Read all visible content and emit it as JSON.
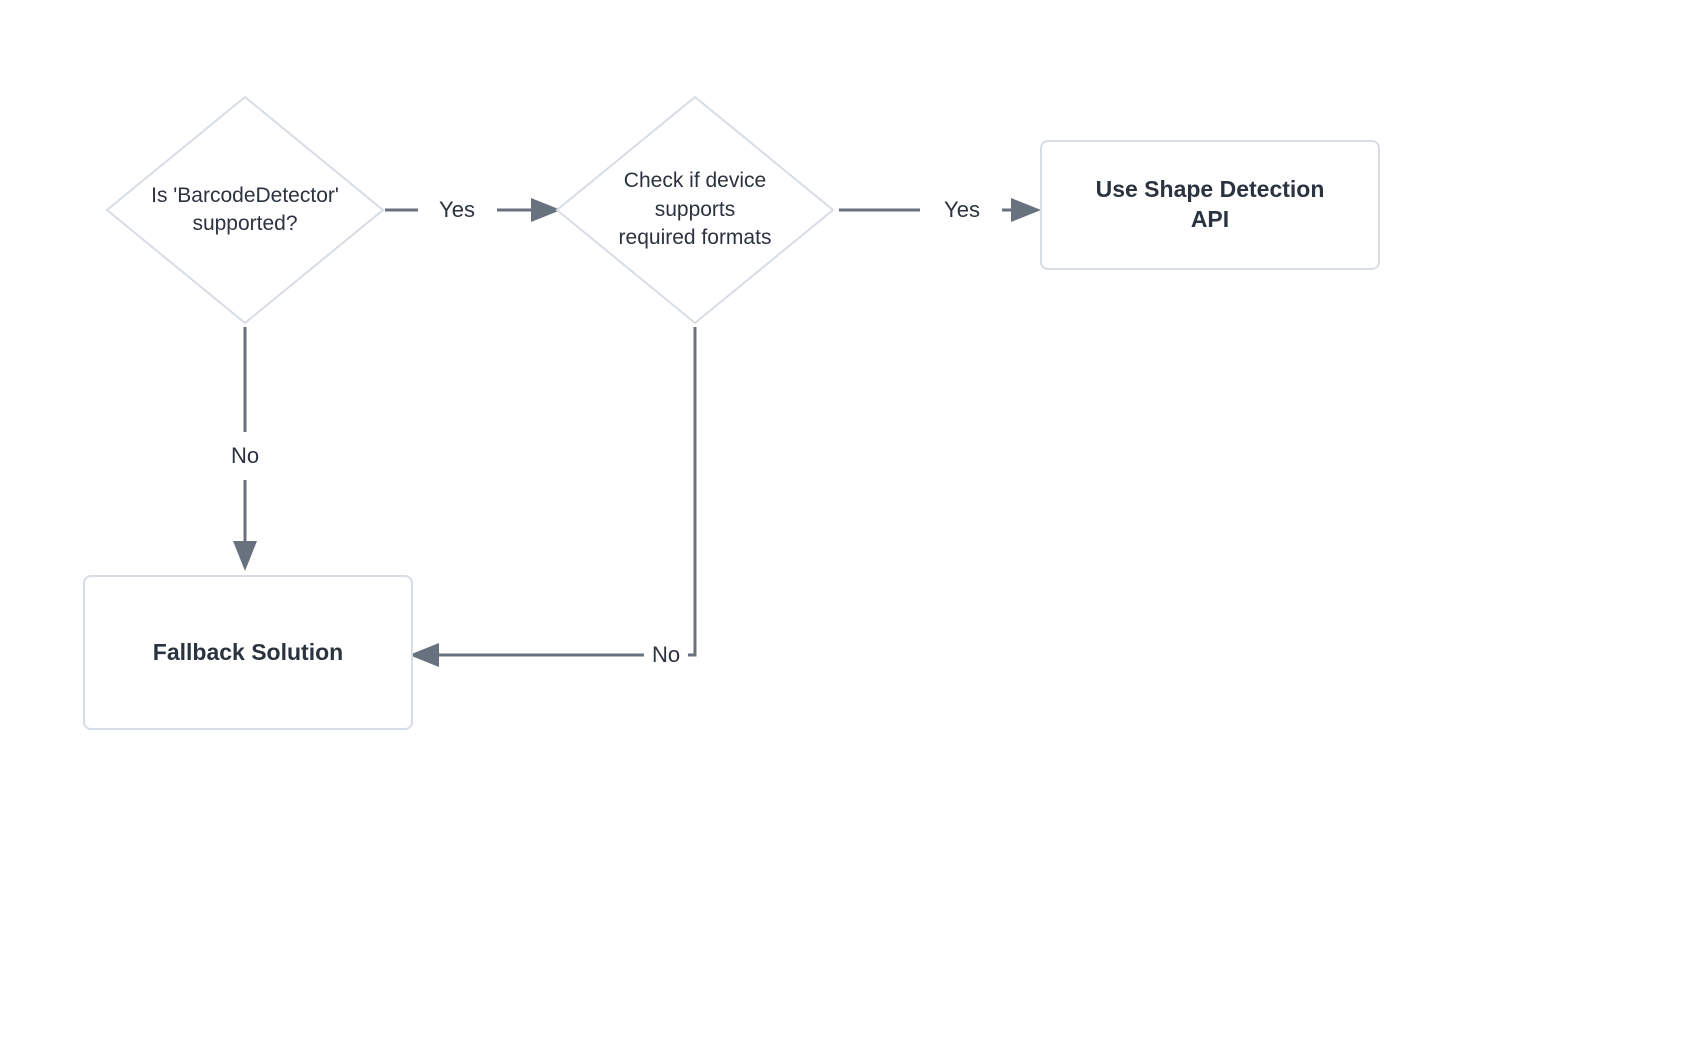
{
  "nodes": {
    "decision1": {
      "text_line1": "Is 'BarcodeDetector'",
      "text_line2": "supported?"
    },
    "decision2": {
      "text_line1": "Check if device supports",
      "text_line2": "required formats"
    },
    "process_result": {
      "text_line1": "Use Shape Detection",
      "text_line2": "API"
    },
    "process_fallback": {
      "text": "Fallback Solution"
    }
  },
  "edges": {
    "d1_yes": "Yes",
    "d1_no": "No",
    "d2_yes": "Yes",
    "d2_no": "No"
  },
  "style": {
    "node_border": "#d7dde5",
    "edge_color": "#68717e",
    "text_color": "#2b3340"
  }
}
